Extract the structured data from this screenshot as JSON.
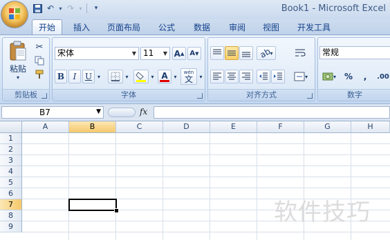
{
  "app": {
    "title": "Book1 - Microsoft Excel"
  },
  "quick_access": {
    "icons": [
      "save-icon",
      "undo-icon",
      "redo-icon",
      "customize-icon"
    ]
  },
  "tabs": [
    {
      "label": "开始",
      "active": true
    },
    {
      "label": "插入"
    },
    {
      "label": "页面布局"
    },
    {
      "label": "公式"
    },
    {
      "label": "数据"
    },
    {
      "label": "审阅"
    },
    {
      "label": "视图"
    },
    {
      "label": "开发工具"
    }
  ],
  "ribbon": {
    "clipboard": {
      "label": "剪贴板",
      "paste_label": "粘贴"
    },
    "font": {
      "label": "字体",
      "font_name": "宋体",
      "font_size": "11",
      "grow_label": "A",
      "shrink_label": "A",
      "bold": "B",
      "italic": "I",
      "underline": "U",
      "font_color_label": "A",
      "phonetic_label": "wén",
      "phonetic_char": "文"
    },
    "alignment": {
      "label": "对齐方式"
    },
    "number": {
      "label": "数字",
      "format": "常规",
      "percent": "%",
      "comma": ",",
      "decimal": ".00"
    }
  },
  "formula_bar": {
    "name_box": "B7",
    "fx": "fx",
    "content": ""
  },
  "sheet": {
    "columns": [
      "A",
      "B",
      "C",
      "D",
      "E",
      "F",
      "G",
      "H"
    ],
    "rows": [
      "1",
      "2",
      "3",
      "4",
      "5",
      "6",
      "7",
      "8",
      "9"
    ],
    "selected_column": "B",
    "selected_row": "7"
  },
  "watermark": "软件技巧",
  "colors": {
    "selection_highlight": "#f6c86b",
    "ribbon_blue": "#d3e2f4",
    "text_blue": "#15428b"
  }
}
